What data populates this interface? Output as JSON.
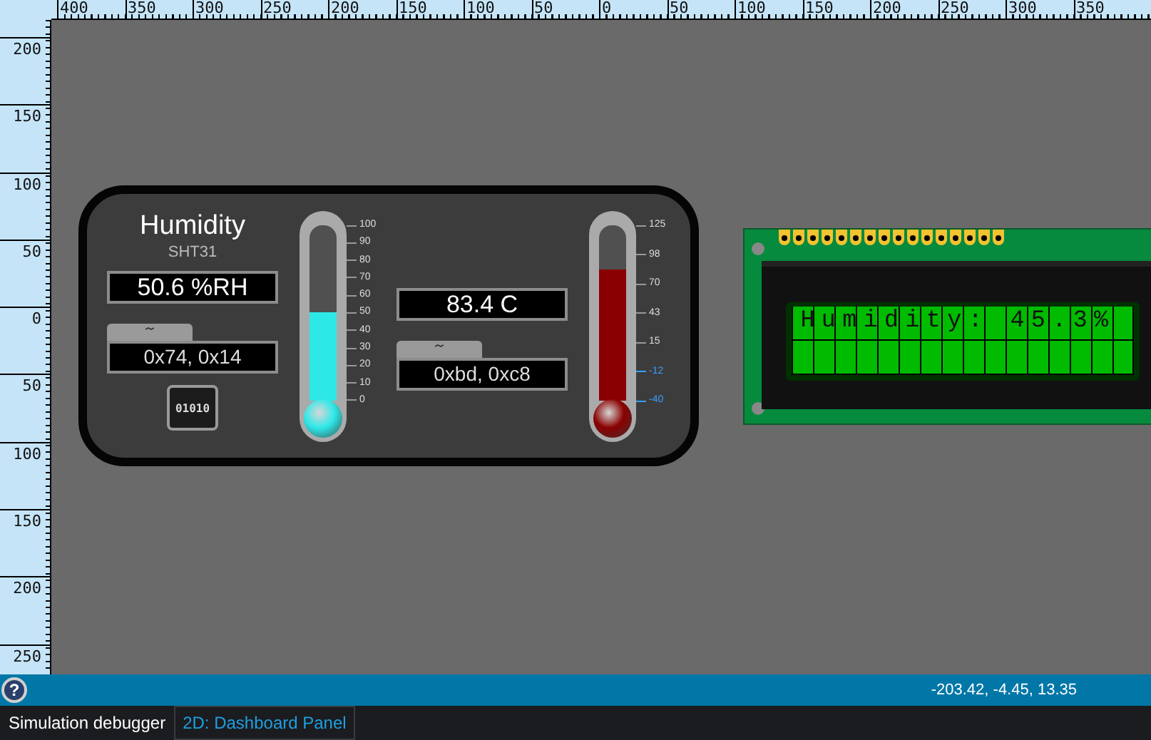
{
  "rulers": {
    "horizontal": [
      "400",
      "350",
      "300",
      "250",
      "200",
      "150",
      "100",
      "50",
      "0",
      "50",
      "100",
      "150",
      "200",
      "250",
      "300",
      "350"
    ],
    "vertical": [
      "200",
      "150",
      "100",
      "50",
      "0",
      "50",
      "100",
      "150",
      "200",
      "250"
    ]
  },
  "dashboard": {
    "title": "Humidity",
    "subtitle": "SHT31",
    "humidity": {
      "reading": "50.6 %RH",
      "raw": "0x74, 0x14"
    },
    "chip_label": "01010",
    "temperature": {
      "reading": "83.4 C",
      "raw": "0xbd, 0xc8"
    },
    "thermometers": [
      {
        "level": 0.506,
        "color": "#2ee8e8",
        "scale": [
          {
            "label": "100",
            "highlighted": false
          },
          {
            "label": "90",
            "highlighted": false
          },
          {
            "label": "80",
            "highlighted": false
          },
          {
            "label": "70",
            "highlighted": false
          },
          {
            "label": "60",
            "highlighted": false
          },
          {
            "label": "50",
            "highlighted": false
          },
          {
            "label": "40",
            "highlighted": false
          },
          {
            "label": "30",
            "highlighted": false
          },
          {
            "label": "20",
            "highlighted": false
          },
          {
            "label": "10",
            "highlighted": false
          },
          {
            "label": "0",
            "highlighted": false
          }
        ]
      },
      {
        "level": 0.748,
        "color": "#8a0000",
        "scale": [
          {
            "label": "125",
            "highlighted": false
          },
          {
            "label": "98",
            "highlighted": false
          },
          {
            "label": "70",
            "highlighted": false
          },
          {
            "label": "43",
            "highlighted": false
          },
          {
            "label": "15",
            "highlighted": false
          },
          {
            "label": "-12",
            "highlighted": true
          },
          {
            "label": "-40",
            "highlighted": true
          }
        ]
      }
    ]
  },
  "lcd": {
    "lines": [
      "Humidity: 45.3%"
    ]
  },
  "status_bar": {
    "help": "?",
    "coordinates": "-203.42, -4.45, 13.35"
  },
  "tabs": [
    {
      "label": "Simulation debugger",
      "selected": false
    },
    {
      "label": "2D: Dashboard Panel",
      "selected": true
    }
  ]
}
